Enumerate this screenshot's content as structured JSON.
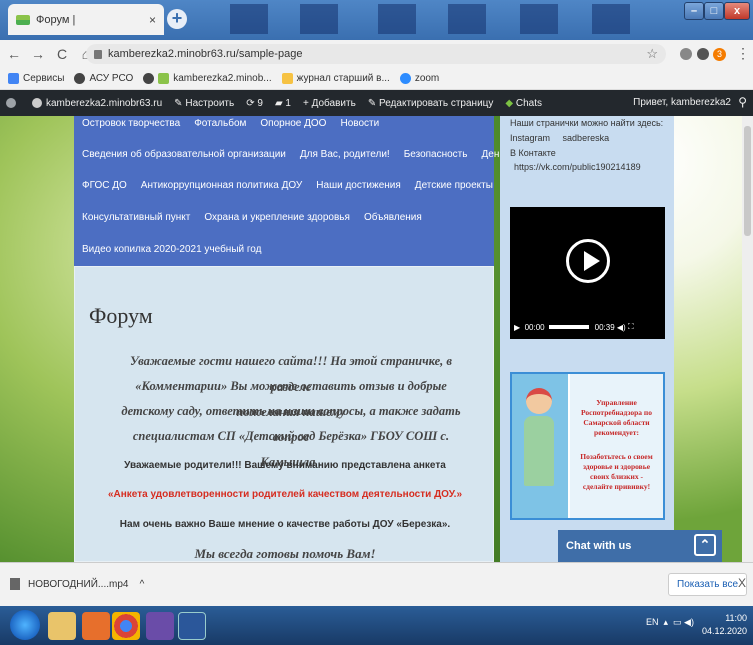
{
  "browser": {
    "tab_title": "Форум |",
    "tab_close": "×",
    "new_tab": "+",
    "win_min": "–",
    "win_max": "□",
    "win_close": "x",
    "url": "kamberezka2.minobr63.ru/sample-page",
    "star": "☆",
    "profile_badge": "3",
    "menu": "⋮",
    "nav_back": "←",
    "nav_forward": "→",
    "nav_reload": "C",
    "nav_home": "⌂",
    "bookmarks": [
      "Сервисы",
      "АСУ РСО",
      "kamberezka2.minob...",
      "журнал старший в...",
      "zoom"
    ]
  },
  "adminbar": {
    "site": "kamberezka2.minobr63.ru",
    "customize": "Настроить",
    "updates": "9",
    "comments": "1",
    "add": "Добавить",
    "edit": "Редактировать страницу",
    "chats": "Chats",
    "greeting": "Привет, kamberezka2",
    "search": "⚲"
  },
  "nav_menu": {
    "row0": [
      "Островок творчества",
      "Фотальбом",
      "Опорное ДОО",
      "Новости"
    ],
    "row1": [
      "Сведения об образовательной организации",
      "Для Вас, родители!",
      "Безопасность",
      "День за днём"
    ],
    "row2": [
      "ФГОС ДО",
      "Антикоррупционная политика ДОУ",
      "Наши достижения",
      "Детские проекты"
    ],
    "row3": [
      "Консультативный пункт",
      "Охрана и укрепление здоровья",
      "Объявления"
    ],
    "row4": [
      "Видео копилка 2020-2021 учебный год"
    ]
  },
  "content": {
    "title": "Форум",
    "para_lines": [
      "Уважаемые гости нашего сайта!!! На этой страничке, в разделе",
      "«Комментарии» Вы можете оставить отзыв и добрые пожелания нашему",
      "детскому саду, ответить на наши вопросы, а также задать вопрос",
      "специалистам СП «Детский сад Берёзка» ГБОУ СОШ с. Камышла ."
    ],
    "parents_line": "Уважаемые родители!!! Вашему вниманию представлена анкета",
    "survey_link": "«Анкета удовлетворенности родителей качеством деятельности ДОУ.»",
    "opinion_line": "Нам очень важно Ваше мнение о качестве работы ДОУ «Березка».",
    "closing": "Мы всегда готовы помочь Вам!"
  },
  "sidebar": {
    "find_us": "Наши странички можно найти здесь:",
    "instagram_label": "Instagram",
    "instagram_handle": "sadbereska",
    "vk_label": "В Контакте",
    "vk_url": "https://vk.com/public190214189",
    "video_time": "00:00",
    "video_duration": "00:39",
    "banner_lines": [
      "Управление",
      "Роспотребнадзора по",
      "Самарской области",
      "рекомендует:",
      "Позаботьтесь о своем",
      "здоровье и здоровье",
      "своих близких -",
      "сделайте прививку!"
    ]
  },
  "chat": {
    "label": "Chat with us",
    "toggle": "⌃"
  },
  "downloads": {
    "file_name": "НОВОГОДНИЙ....mp4",
    "chevron": "^",
    "show_all": "Показать все",
    "close": "X"
  },
  "taskbar": {
    "lang": "EN",
    "time": "11:00",
    "date": "04.12.2020"
  },
  "colors": {
    "nav_bg": "#4c6ec2",
    "content_bg": "#d6e5ef",
    "survey_link": "#d62d20",
    "chat_bg": "#3f6ea8",
    "adminbar_bg": "#23282d"
  }
}
